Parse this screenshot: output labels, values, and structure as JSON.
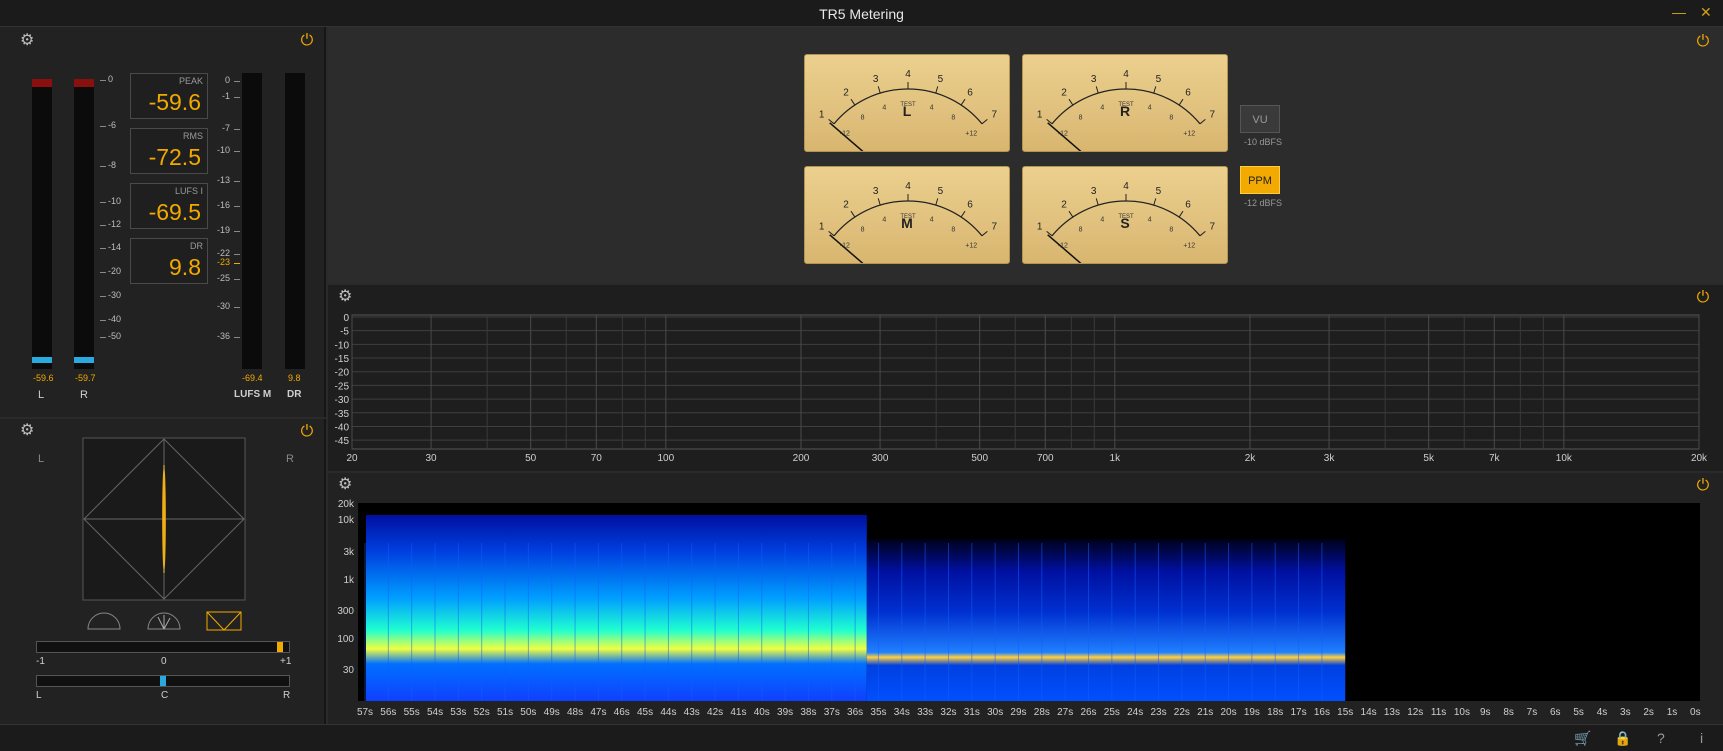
{
  "window": {
    "title": "TR5 Metering",
    "minimize_icon": "minimize-icon",
    "close_icon": "close-icon"
  },
  "level_meter": {
    "channels": [
      {
        "label": "L",
        "value": "-59.6"
      },
      {
        "label": "R",
        "value": "-59.7"
      }
    ],
    "scale": [
      "0",
      "-6",
      "-8",
      "-10",
      "-12",
      "-14",
      "-20",
      "-30",
      "-40",
      "-50"
    ],
    "readouts": [
      {
        "label": "PEAK",
        "value": "-59.6"
      },
      {
        "label": "RMS",
        "value": "-72.5"
      },
      {
        "label": "LUFS I",
        "value": "-69.5"
      },
      {
        "label": "DR",
        "value": "9.8"
      }
    ],
    "lufs_scale": [
      "0",
      "-1",
      "-7",
      "-10",
      "-13",
      "-16",
      "-19",
      "-22",
      "-23",
      "-25",
      "-30",
      "-36"
    ],
    "lufs_meter": {
      "label": "LUFS M",
      "value": "-69.4"
    },
    "dr_meter": {
      "label": "DR",
      "value": "9.8"
    }
  },
  "vu_panel": {
    "meters": [
      {
        "label": "L"
      },
      {
        "label": "R"
      },
      {
        "label": "M"
      },
      {
        "label": "S"
      }
    ],
    "scale_top": [
      "1",
      "2",
      "3",
      "4",
      "5",
      "6",
      "7"
    ],
    "scale_bottom": [
      "-12",
      "8",
      "4",
      "TEST",
      "4",
      "8",
      "+12"
    ],
    "modes": [
      {
        "label": "VU",
        "sub": "-10 dBFS",
        "active": false
      },
      {
        "label": "PPM",
        "sub": "-12 dBFS",
        "active": true
      }
    ],
    "colors": {
      "face": "#e6c885",
      "active": "#f2a900"
    }
  },
  "stereo_panel": {
    "left_label": "L",
    "right_label": "R",
    "correlation": {
      "min": "-1",
      "mid": "0",
      "max": "+1",
      "value": 0.95
    },
    "balance": {
      "left": "L",
      "center": "C",
      "right": "R",
      "value": 0.5
    }
  },
  "spectrum_panel": {
    "y_labels": [
      "0",
      "-5",
      "-10",
      "-15",
      "-20",
      "-25",
      "-30",
      "-35",
      "-40",
      "-45"
    ],
    "x_labels": [
      "20",
      "30",
      "50",
      "70",
      "100",
      "200",
      "300",
      "500",
      "700",
      "1k",
      "2k",
      "3k",
      "5k",
      "7k",
      "10k",
      "20k"
    ]
  },
  "spectrogram_panel": {
    "y_labels": [
      "20k",
      "10k",
      "3k",
      "1k",
      "300",
      "100",
      "30"
    ],
    "time_labels": [
      "57s",
      "56s",
      "55s",
      "54s",
      "53s",
      "52s",
      "51s",
      "50s",
      "49s",
      "48s",
      "47s",
      "46s",
      "45s",
      "44s",
      "43s",
      "42s",
      "41s",
      "40s",
      "39s",
      "38s",
      "37s",
      "36s",
      "35s",
      "34s",
      "33s",
      "32s",
      "31s",
      "30s",
      "29s",
      "28s",
      "27s",
      "26s",
      "25s",
      "24s",
      "23s",
      "22s",
      "21s",
      "20s",
      "19s",
      "18s",
      "17s",
      "16s",
      "15s",
      "14s",
      "13s",
      "12s",
      "11s",
      "10s",
      "9s",
      "8s",
      "7s",
      "6s",
      "5s",
      "4s",
      "3s",
      "2s",
      "1s",
      "0s"
    ]
  },
  "footer": {
    "icons": [
      "cart-icon",
      "lock-icon",
      "help-icon",
      "info-icon"
    ],
    "glyphs": [
      "🛒",
      "🔒",
      "?",
      "i"
    ]
  }
}
